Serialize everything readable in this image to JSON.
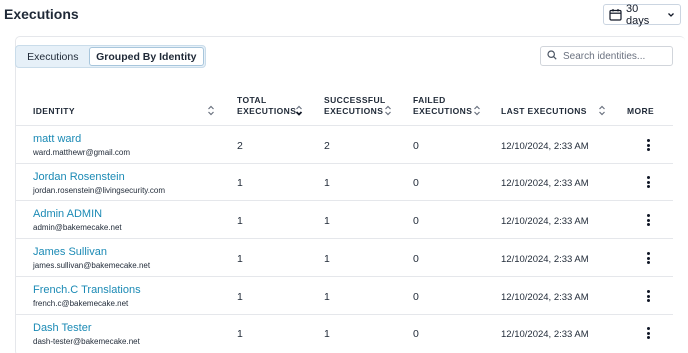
{
  "header": {
    "title": "Executions",
    "date_range": "30 days"
  },
  "tabs": [
    {
      "label": "Executions",
      "active": false
    },
    {
      "label": "Grouped By Identity",
      "active": true
    }
  ],
  "search": {
    "placeholder": "Search identities..."
  },
  "table": {
    "columns": {
      "identity": "IDENTITY",
      "total_1": "TOTAL",
      "total_2": "EXECUTIONS",
      "successful_1": "SUCCESSFUL",
      "successful_2": "EXECUTIONS",
      "failed_1": "FAILED",
      "failed_2": "EXECUTIONS",
      "last": "LAST EXECUTIONS",
      "more": "MORE"
    },
    "rows": [
      {
        "name": "matt ward",
        "email": "ward.matthewr@gmail.com",
        "total": "2",
        "successful": "2",
        "failed": "0",
        "last": "12/10/2024, 2:33 AM"
      },
      {
        "name": "Jordan Rosenstein",
        "email": "jordan.rosenstein@livingsecurity.com",
        "total": "1",
        "successful": "1",
        "failed": "0",
        "last": "12/10/2024, 2:33 AM"
      },
      {
        "name": "Admin ADMIN",
        "email": "admin@bakemecake.net",
        "total": "1",
        "successful": "1",
        "failed": "0",
        "last": "12/10/2024, 2:33 AM"
      },
      {
        "name": "James Sullivan",
        "email": "james.sullivan@bakemecake.net",
        "total": "1",
        "successful": "1",
        "failed": "0",
        "last": "12/10/2024, 2:33 AM"
      },
      {
        "name": "French.C Translations",
        "email": "french.c@bakemecake.net",
        "total": "1",
        "successful": "1",
        "failed": "0",
        "last": "12/10/2024, 2:33 AM"
      },
      {
        "name": "Dash Tester",
        "email": "dash-tester@bakemecake.net",
        "total": "1",
        "successful": "1",
        "failed": "0",
        "last": "12/10/2024, 2:33 AM"
      }
    ]
  },
  "icons": {
    "calendar": "calendar-icon",
    "chevron": "chevron-down-icon",
    "search": "search-icon",
    "sort": "sort-icon",
    "sort_desc": "sort-desc-icon",
    "more": "more-vertical-icon"
  },
  "colors": {
    "link": "#1b8ab5",
    "tab_bg": "#e6f0f8"
  }
}
